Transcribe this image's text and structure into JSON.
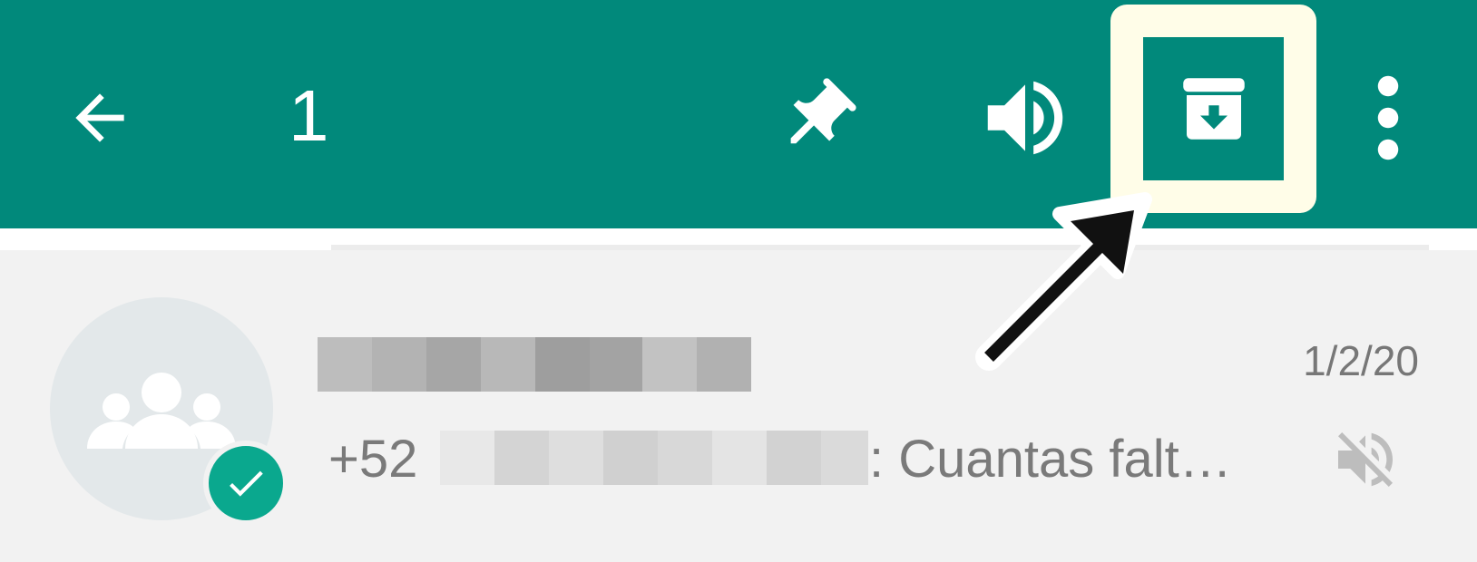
{
  "toolbar": {
    "background": "#01897b",
    "selected_count": "1",
    "icons": {
      "back": "arrow-left-icon",
      "pin": "pin-icon",
      "unmute": "volume-up-icon",
      "archive": "archive-icon",
      "menu": "more-vertical-icon"
    }
  },
  "highlight": {
    "color": "#fffde8"
  },
  "chat": {
    "date": "1/2/20",
    "sender_prefix": "+52",
    "message": ": Cuantas falt…",
    "icons": {
      "avatar": "group-icon",
      "selected": "check-icon",
      "muted": "volume-off-icon"
    },
    "accent": "#0aa88e"
  }
}
